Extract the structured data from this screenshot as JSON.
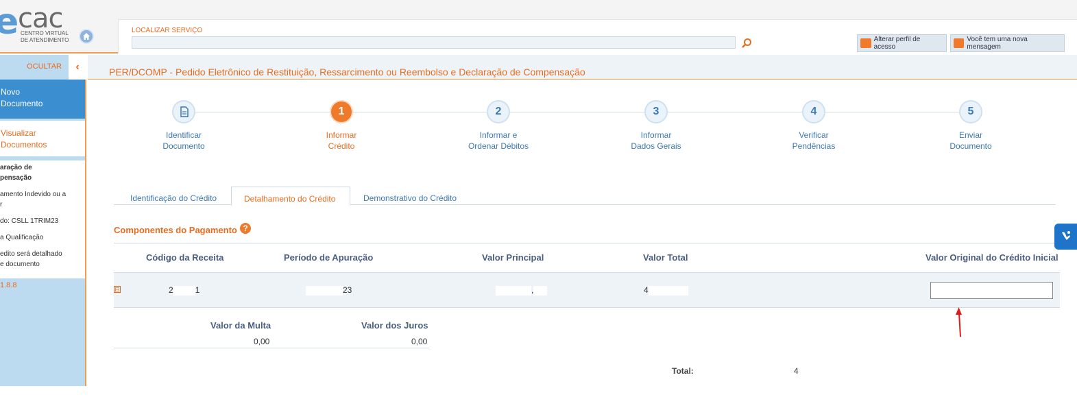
{
  "header": {
    "logo_e": "e",
    "logo_cac": "cac",
    "logo_sub1": "CENTRO VIRTUAL",
    "logo_sub2": "DE ATENDIMENTO",
    "search_label": "LOCALIZAR SERVIÇO",
    "search_value": "",
    "btn_perfil": "Alterar perfil de acesso",
    "btn_msg": "Você tem uma nova mensagem"
  },
  "sidebar": {
    "ocultar": "OCULTAR",
    "novo_line1": "Novo",
    "novo_line2": "Documento",
    "visualizar_line1": "Visualizar",
    "visualizar_line2": "Documentos",
    "entries": [
      "aração de",
      "pensação",
      "amento Indevido ou a",
      "r",
      "do: CSLL 1TRIM23",
      "a Qualificação",
      "edito será detalhado",
      "e documento"
    ],
    "version": "1.8.8"
  },
  "page": {
    "title": "PER/DCOMP - Pedido Eletrônico de Restituição, Ressarcimento ou Reembolso e Declaração de Compensação"
  },
  "steps": [
    {
      "num": "",
      "icon": "document-icon",
      "l1": "Identificar",
      "l2": "Documento"
    },
    {
      "num": "1",
      "l1": "Informar",
      "l2": "Crédito"
    },
    {
      "num": "2",
      "l1": "Informar e",
      "l2": "Ordenar Débitos"
    },
    {
      "num": "3",
      "l1": "Informar",
      "l2": "Dados Gerais"
    },
    {
      "num": "4",
      "l1": "Verificar",
      "l2": "Pendências"
    },
    {
      "num": "5",
      "l1": "Enviar",
      "l2": "Documento"
    }
  ],
  "tabs": [
    "Identificação do Crédito",
    "Detalhamento do Crédito",
    "Demonstrativo do Crédito"
  ],
  "section": {
    "title": "Componentes do Pagamento",
    "help": "?"
  },
  "table": {
    "headers": [
      "Código da Receita",
      "Período de Apuração",
      "Valor Principal",
      "Valor Total",
      "Valor Original do Crédito Inicial"
    ],
    "row": {
      "collapse": "⊟",
      "codigo_a": "2",
      "codigo_b": "1",
      "periodo_b": "23",
      "principal_a": "",
      "principal_b": ",",
      "total_a": "4"
    }
  },
  "subtable": {
    "headers": [
      "Valor da Multa",
      "Valor dos Juros"
    ],
    "values": [
      "0,00",
      "0,00"
    ]
  },
  "total": {
    "label": "Total:",
    "value": "4"
  },
  "colors": {
    "accent": "#e86c1f",
    "primary": "#3b8fd1",
    "text_header": "#4a5f80"
  }
}
